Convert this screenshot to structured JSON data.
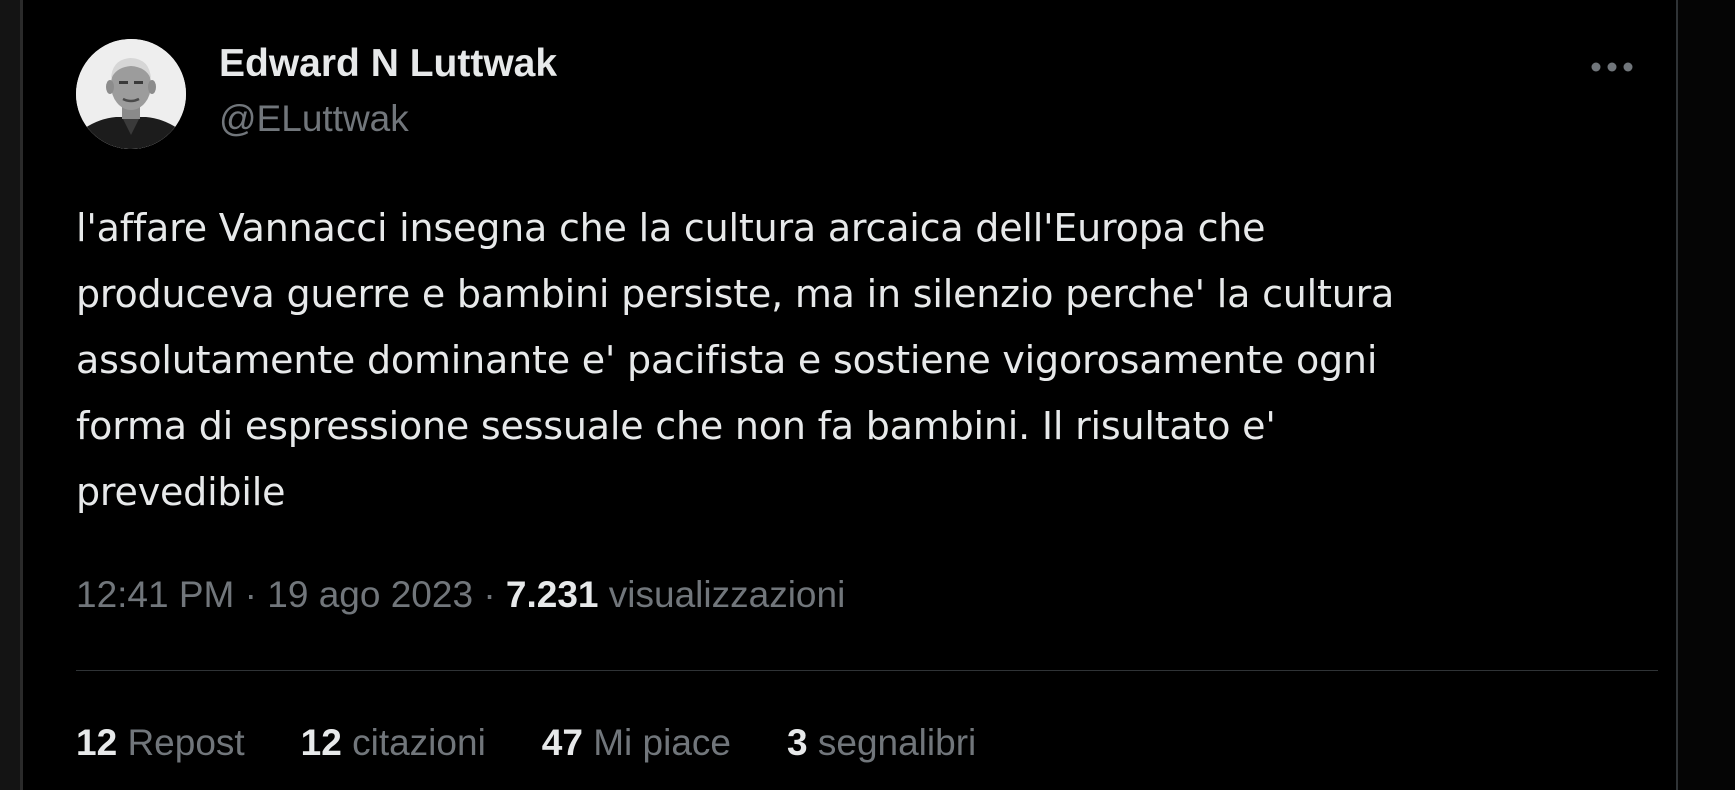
{
  "colors": {
    "background": "#000000",
    "primary_text": "#e7e9ea",
    "secondary_text": "#71767b",
    "divider": "#2f3336"
  },
  "author": {
    "display_name": "Edward N Luttwak",
    "handle": "@ELuttwak",
    "avatar_icon": "profile-photo-avatar"
  },
  "menu": {
    "icon": "more-horizontal-icon"
  },
  "tweet": {
    "text": "l'affare Vannacci insegna che la cultura arcaica dell'Europa che\nproduceva guerre e bambini persiste, ma in silenzio perche' la cultura\nassolutamente dominante e' pacifista e sostiene vigorosamente ogni\nforma di espressione sessuale che non fa bambini. Il risultato e'\nprevedibile"
  },
  "meta": {
    "time": "12:41 PM",
    "separator": "·",
    "date": "19 ago 2023",
    "views_count": "7.231",
    "views_label": "visualizzazioni"
  },
  "stats": {
    "reposts_count": "12",
    "reposts_label": "Repost",
    "quotes_count": "12",
    "quotes_label": "citazioni",
    "likes_count": "47",
    "likes_label": "Mi piace",
    "bookmarks_count": "3",
    "bookmarks_label": "segnalibri"
  }
}
